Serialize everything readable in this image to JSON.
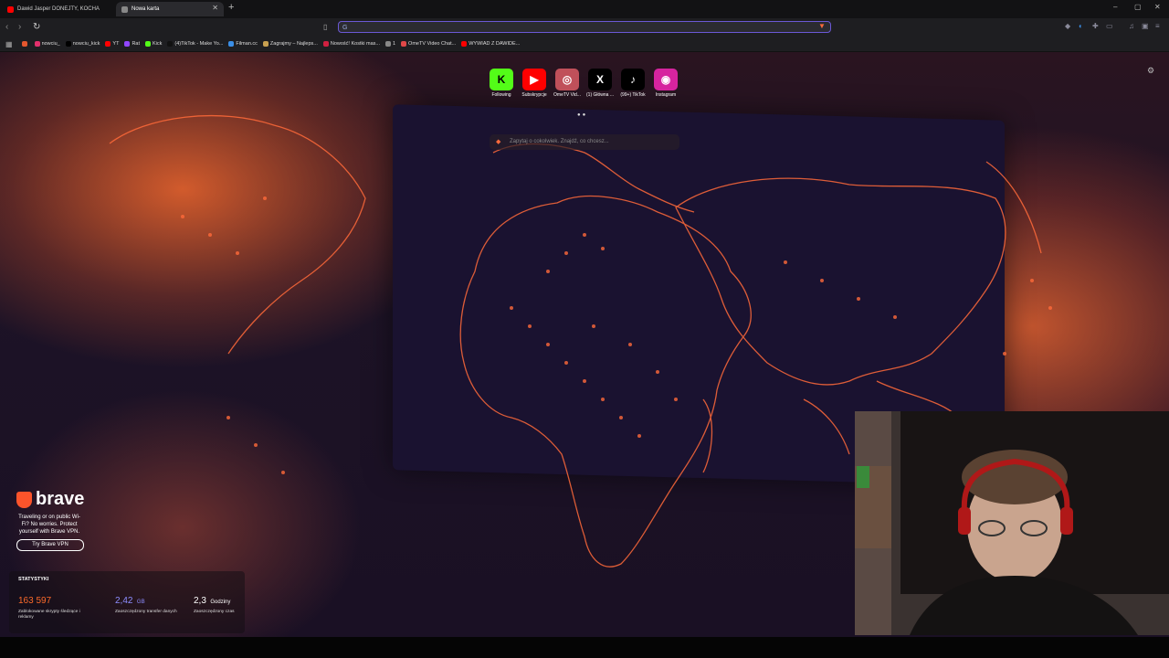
{
  "tabs": [
    {
      "title": "Dawid Jasper DONEJTY, KOCHA",
      "active": false
    },
    {
      "title": "Nowa karta",
      "active": true
    }
  ],
  "window_controls": {
    "minimize": "–",
    "restore": "▢",
    "close": "✕"
  },
  "address_bar": {
    "value": "",
    "search_engine_icon": "google-icon"
  },
  "bookmarks": [
    {
      "label": "nowciu_",
      "color": "#e1306c"
    },
    {
      "label": "nowciu_kick",
      "color": "#000000"
    },
    {
      "label": "YT",
      "color": "#ff0000"
    },
    {
      "label": "Rat",
      "color": "#9146ff"
    },
    {
      "label": "Kick",
      "color": "#53fc18"
    },
    {
      "label": "(4)TikTok - Make Yo...",
      "color": "#111111"
    },
    {
      "label": "Filman.cc",
      "color": "#3a8ee6"
    },
    {
      "label": "Zagrajmy – Najleps...",
      "color": "#c8a050"
    },
    {
      "label": "Nowość! Kostki mas...",
      "color": "#d02040"
    },
    {
      "label": "1",
      "color": "#888888"
    },
    {
      "label": "OmeTV Video Chat...",
      "color": "#e04848"
    },
    {
      "label": "WYWIAD Z DAWIDE...",
      "color": "#ff0000"
    }
  ],
  "top_sites": [
    {
      "label": "Following",
      "glyph": "K",
      "bg": "#53fc18",
      "fg": "#000000"
    },
    {
      "label": "Subskrypcje",
      "glyph": "▶",
      "bg": "#ff0000",
      "fg": "#ffffff"
    },
    {
      "label": "OmeTV Vid...",
      "glyph": "◎",
      "bg": "#c0505a",
      "fg": "#ffffff"
    },
    {
      "label": "(1) Główna ...",
      "glyph": "X",
      "bg": "#000000",
      "fg": "#ffffff"
    },
    {
      "label": "(99+) TikTok",
      "glyph": "♪",
      "bg": "#000000",
      "fg": "#ffffff"
    },
    {
      "label": "Instagram",
      "glyph": "◉",
      "bg": "#d6249f",
      "fg": "#ffffff"
    }
  ],
  "search_placeholder": "Zapytaj o cokolwiek. Znajdź, co chcesz...",
  "brave": {
    "name": "brave",
    "promo": "Traveling or on public Wi-Fi? No worries. Protect yourself with Brave VPN.",
    "button": "Try Brave VPN"
  },
  "stats": {
    "header": "STATYSTYKI",
    "items": [
      {
        "value": "163 597",
        "unit": "",
        "desc": "Zablokowane skrypty śledzące i reklamy",
        "color": "#fb6a2a"
      },
      {
        "value": "2,42",
        "unit": "GB",
        "desc": "Zaoszczędzony transfer danych",
        "color": "#8d8dff"
      },
      {
        "value": "2,3",
        "unit": "Godziny",
        "desc": "Zaoszczędzony czas",
        "color": "#ffffff"
      }
    ]
  }
}
